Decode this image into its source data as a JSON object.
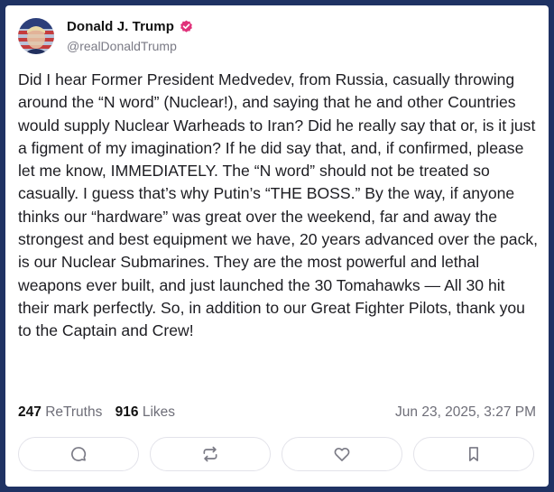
{
  "post": {
    "author": {
      "display_name": "Donald J. Trump",
      "handle": "@realDonaldTrump",
      "verified": true,
      "verified_color": "#e0317a"
    },
    "text": "Did I hear Former President Medvedev, from Russia, casually throwing around the “N word” (Nuclear!), and saying that he and other Countries would supply Nuclear Warheads to Iran? Did he really say that or, is it just a figment of my imagination? If he did say that, and, if confirmed, please let me know, IMMEDIATELY. The “N word” should not be treated so casually. I guess that’s why Putin’s “THE BOSS.” By the way, if anyone thinks our “hardware” was great over the weekend, far and away the strongest and best equipment we have, 20 years advanced over the pack, is our Nuclear Submarines. They are the most powerful and lethal weapons ever built, and just launched the 30 Tomahawks — All 30 hit their mark perfectly. So, in addition to our Great Fighter Pilots, thank you to the Captain and Crew!",
    "stats": {
      "retruths_count": "247",
      "retruths_label": "ReTruths",
      "likes_count": "916",
      "likes_label": "Likes"
    },
    "timestamp": "Jun 23, 2025, 3:27 PM",
    "actions": [
      {
        "icon": "reply-icon"
      },
      {
        "icon": "retruth-icon"
      },
      {
        "icon": "heart-icon"
      },
      {
        "icon": "bookmark-icon"
      }
    ]
  },
  "colors": {
    "background_frame": "#1f3263",
    "card": "#ffffff",
    "text": "#1d1d22",
    "muted": "#6e6e78",
    "icon": "#7a7a85",
    "action_border": "#e3e3ea"
  }
}
